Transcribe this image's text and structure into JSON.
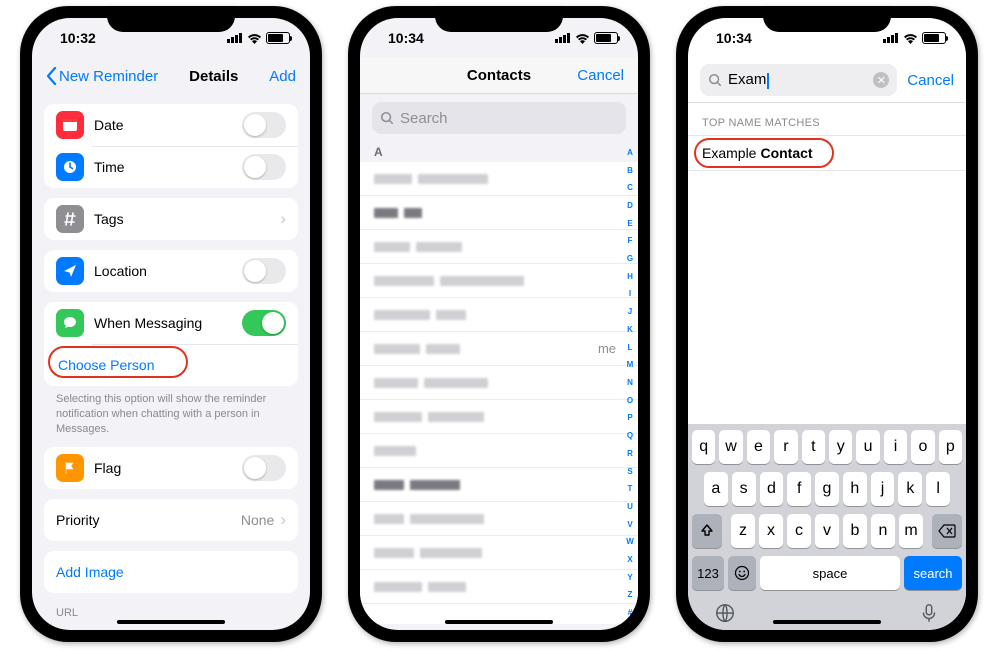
{
  "phone1": {
    "time": "10:32",
    "back": "New Reminder",
    "title": "Details",
    "add": "Add",
    "date": "Date",
    "timeRow": "Time",
    "tags": "Tags",
    "location": "Location",
    "messaging": "When Messaging",
    "choose": "Choose Person",
    "footnote": "Selecting this option will show the reminder notification when chatting with a person in Messages.",
    "flag": "Flag",
    "priority": "Priority",
    "priorityValue": "None",
    "addImage": "Add Image",
    "url": "URL"
  },
  "phone2": {
    "time": "10:34",
    "title": "Contacts",
    "cancel": "Cancel",
    "searchPlaceholder": "Search",
    "section": "A",
    "meLabel": "me",
    "index": [
      "A",
      "B",
      "C",
      "D",
      "E",
      "F",
      "G",
      "H",
      "I",
      "J",
      "K",
      "L",
      "M",
      "N",
      "O",
      "P",
      "Q",
      "R",
      "S",
      "T",
      "U",
      "V",
      "W",
      "X",
      "Y",
      "Z",
      "#"
    ]
  },
  "phone3": {
    "time": "10:34",
    "query": "Exam",
    "cancel": "Cancel",
    "sectionLabel": "TOP NAME MATCHES",
    "resultFirst": "Example",
    "resultLast": "Contact",
    "keys_r1": [
      "q",
      "w",
      "e",
      "r",
      "t",
      "y",
      "u",
      "i",
      "o",
      "p"
    ],
    "keys_r2": [
      "a",
      "s",
      "d",
      "f",
      "g",
      "h",
      "j",
      "k",
      "l"
    ],
    "keys_r3": [
      "z",
      "x",
      "c",
      "v",
      "b",
      "n",
      "m"
    ],
    "numKey": "123",
    "space": "space",
    "search": "search"
  }
}
